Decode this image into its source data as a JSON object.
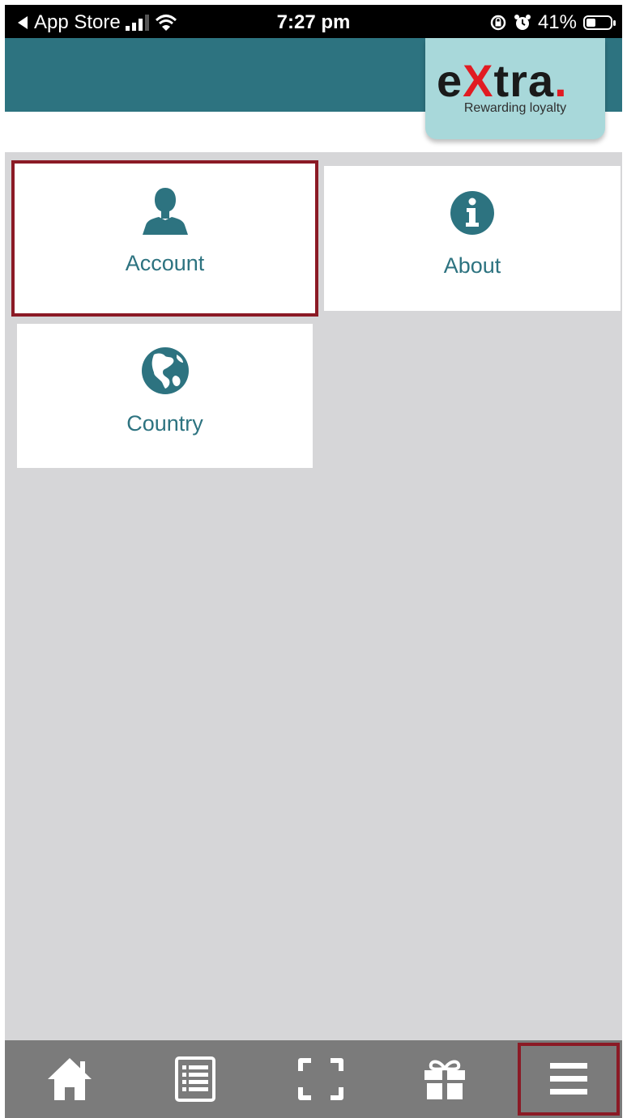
{
  "status_bar": {
    "back_label": "App Store",
    "time": "7:27 pm",
    "battery": "41%",
    "battery_level": 0.41
  },
  "logo": {
    "prefix": "e",
    "x_letter": "X",
    "suffix": "tra",
    "dot": ".",
    "tagline": "Rewarding loyalty"
  },
  "tiles": [
    {
      "label": "Account",
      "icon": "user-icon",
      "selected": true
    },
    {
      "label": "About",
      "icon": "info-icon",
      "selected": false
    },
    {
      "label": "Country",
      "icon": "globe-icon",
      "selected": false
    }
  ],
  "bottom_nav": [
    {
      "icon": "home-icon"
    },
    {
      "icon": "list-icon"
    },
    {
      "icon": "scan-icon"
    },
    {
      "icon": "gift-icon"
    },
    {
      "icon": "menu-icon",
      "selected": true
    }
  ],
  "colors": {
    "header": "#2d7380",
    "accent_text": "#2d7380",
    "logo_card": "#a8d8da",
    "logo_red": "#e11b22",
    "selection_border": "#8b1a25",
    "content_bg": "#d6d6d8",
    "nav_bg": "#7b7b7b"
  }
}
